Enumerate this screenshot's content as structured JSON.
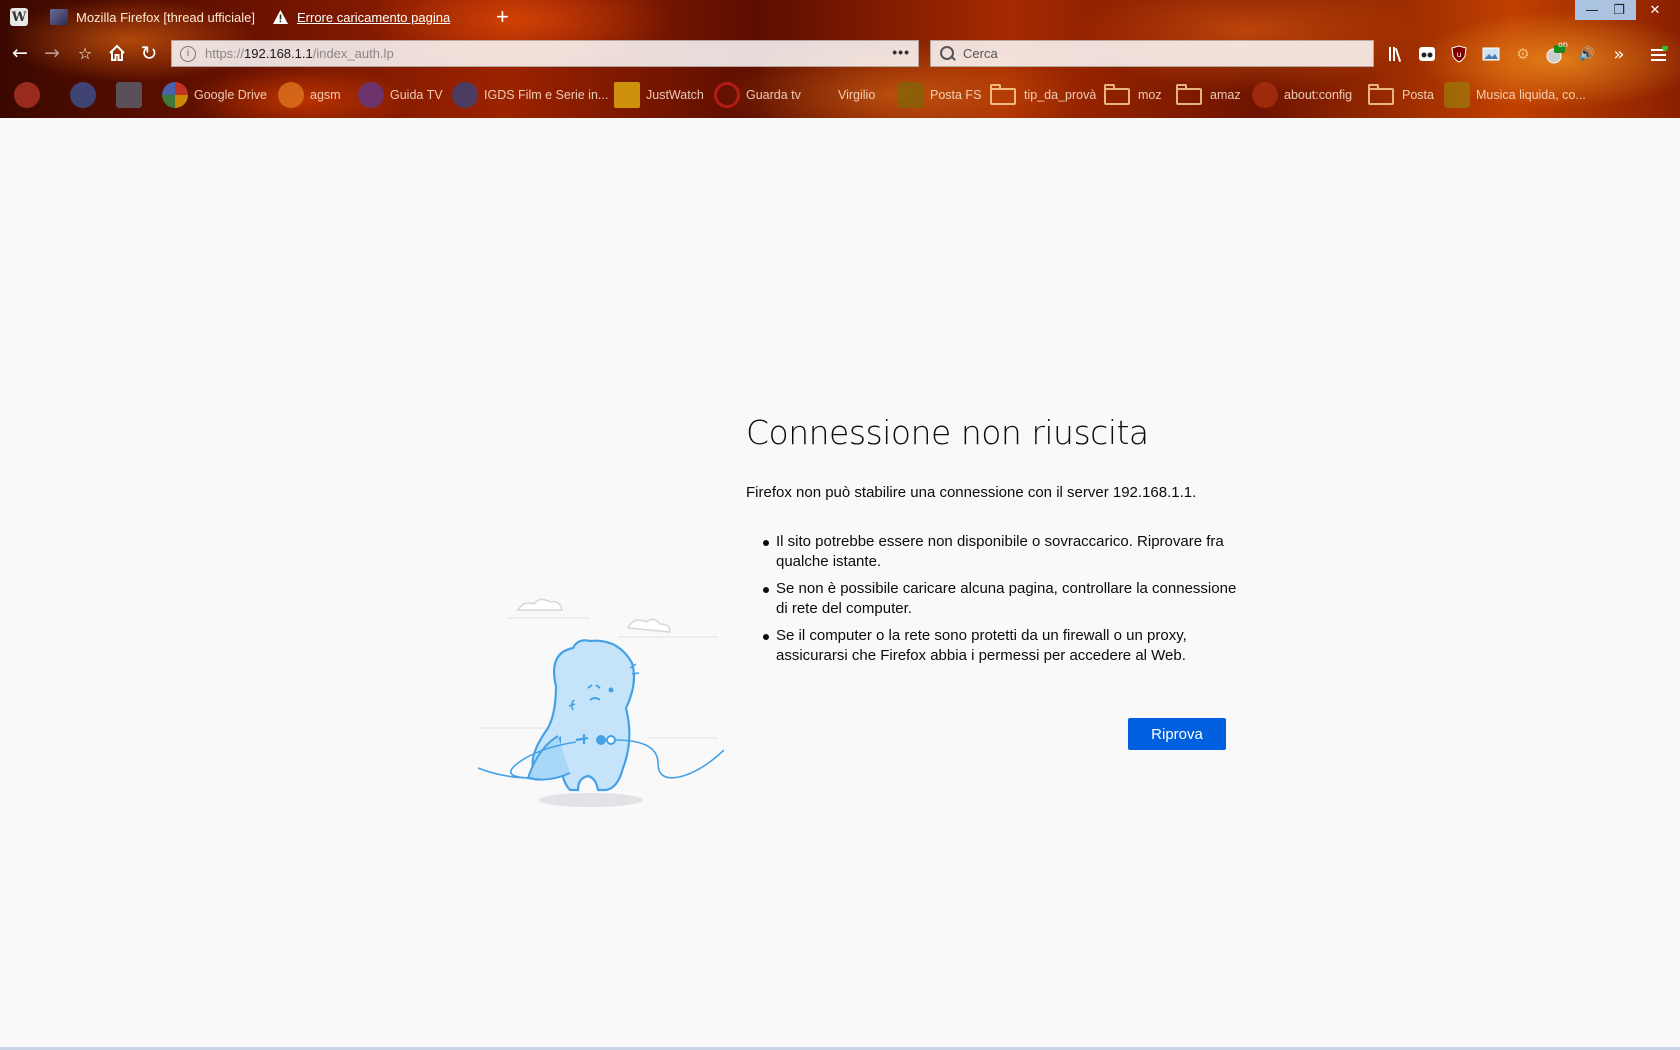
{
  "tabs": [
    {
      "label": "Mozilla Firefox [thread ufficiale]",
      "active": false
    },
    {
      "label": "Errore caricamento pagina",
      "active": true
    }
  ],
  "window": {
    "app_icon_letter": "W",
    "minimize_glyph": "—",
    "maximize_glyph": "❐",
    "close_glyph": "✕",
    "new_tab_glyph": "+"
  },
  "urlbar": {
    "scheme": "https://",
    "host": "192.168.1.1",
    "path": "/index_auth.lp",
    "more_glyph": "•••"
  },
  "searchbar": {
    "placeholder": "Cerca"
  },
  "toolbar_badge": "on",
  "bookmarks": [
    {
      "label": "Google Drive",
      "icon": "google-icon"
    },
    {
      "label": "agsm",
      "icon": "agsm-icon"
    },
    {
      "label": "Guida TV",
      "icon": "guida-tv-icon"
    },
    {
      "label": "IGDS Film e Serie in...",
      "icon": "igds-icon"
    },
    {
      "label": "JustWatch",
      "icon": "justwatch-icon"
    },
    {
      "label": "Guarda tv",
      "icon": "guarda-tv-icon"
    },
    {
      "label": "Virgilio",
      "icon": "virgilio-icon"
    },
    {
      "label": "Posta FS",
      "icon": "posta-fs-icon"
    },
    {
      "label": "tip_da_provà",
      "icon": "folder-icon"
    },
    {
      "label": "moz",
      "icon": "folder-icon"
    },
    {
      "label": "amaz",
      "icon": "folder-icon"
    },
    {
      "label": "about:config",
      "icon": "about-config-icon"
    },
    {
      "label": "Posta",
      "icon": "folder-icon"
    },
    {
      "label": "Musica liquida, co...",
      "icon": "musica-icon"
    }
  ],
  "error": {
    "title": "Connessione non riuscita",
    "description": "Firefox non può stabilire una connessione con il server 192.168.1.1.",
    "tips": [
      "Il sito potrebbe essere non disponibile o sovraccarico. Riprovare fra qualche istante.",
      "Se non è possibile caricare alcuna pagina, controllare la connessione di rete del computer.",
      "Se il computer o la rete sono protetti da un firewall o un proxy, assicurarsi che Firefox abbia i permessi per accedere al Web."
    ],
    "retry_label": "Riprova"
  },
  "colors": {
    "accent": "#0060df",
    "page_bg": "#f9f9fa",
    "illustration_stroke": "#45a1e6",
    "illustration_fill": "#c5e4fa"
  }
}
